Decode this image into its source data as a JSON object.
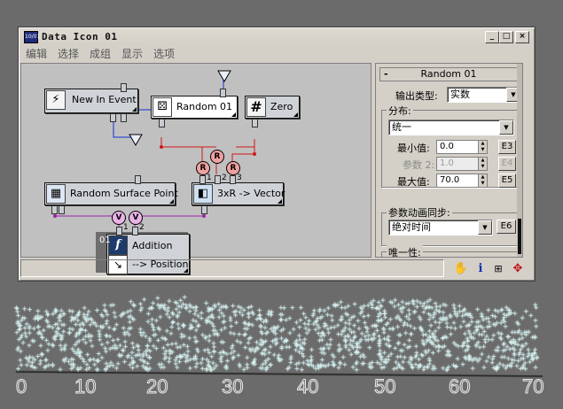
{
  "window": {
    "title": "Data Icon 01",
    "icon_text": "10/01",
    "buttons": {
      "minimize": "_",
      "maximize": "□",
      "close": "×"
    }
  },
  "menu": [
    "编辑",
    "选择",
    "成组",
    "显示",
    "选项"
  ],
  "nodes": {
    "new_in_event": "New In Event",
    "random01": "Random 01",
    "zero": "Zero",
    "random_surface_point": "Random Surface Point",
    "vector": "3xR -> Vector",
    "addition": "Addition",
    "addition_out": "--> Position",
    "addition_index": "01",
    "op_r": "R",
    "op_v": "V",
    "port_nums": [
      "1",
      "2",
      "3",
      "1",
      "2"
    ]
  },
  "panel": {
    "rollout_title": "Random 01",
    "rollout_toggle": "-",
    "output_type_label": "输出类型:",
    "output_type_value": "实数",
    "distribution_group": "分布:",
    "distribution_value": "统一",
    "min_label": "最小值:",
    "min_value": "0.0",
    "min_btn": "E3",
    "param2_label": "参数 2:",
    "param2_value": "1.0",
    "param2_btn": "E4",
    "max_label": "最大值:",
    "max_value": "70.0",
    "max_btn": "E5",
    "anim_sync_group": "参数动画同步:",
    "anim_sync_value": "绝对时间",
    "anim_sync_btn": "E6",
    "uniqueness_group": "唯一性:"
  },
  "status_icons": [
    "hand-icon",
    "info-icon",
    "node-grid-icon",
    "move-icon"
  ],
  "viewport": {
    "axis_labels": [
      "0",
      "10",
      "20",
      "30",
      "40",
      "50",
      "60",
      "70"
    ]
  },
  "colors": {
    "blue_wire": "#1030d0",
    "red_wire": "#d01818",
    "purple_wire": "#a020b0",
    "particle": "#d8f4f4"
  }
}
